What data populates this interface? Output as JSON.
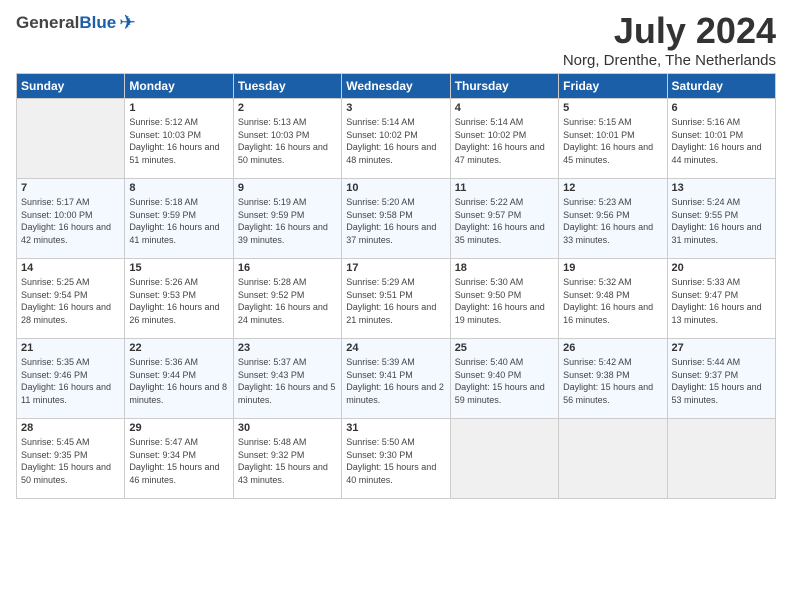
{
  "logo": {
    "general": "General",
    "blue": "Blue"
  },
  "header": {
    "month": "July 2024",
    "location": "Norg, Drenthe, The Netherlands"
  },
  "weekdays": [
    "Sunday",
    "Monday",
    "Tuesday",
    "Wednesday",
    "Thursday",
    "Friday",
    "Saturday"
  ],
  "weeks": [
    [
      {
        "day": "",
        "empty": true
      },
      {
        "day": "1",
        "sunrise": "Sunrise: 5:12 AM",
        "sunset": "Sunset: 10:03 PM",
        "daylight": "Daylight: 16 hours and 51 minutes."
      },
      {
        "day": "2",
        "sunrise": "Sunrise: 5:13 AM",
        "sunset": "Sunset: 10:03 PM",
        "daylight": "Daylight: 16 hours and 50 minutes."
      },
      {
        "day": "3",
        "sunrise": "Sunrise: 5:14 AM",
        "sunset": "Sunset: 10:02 PM",
        "daylight": "Daylight: 16 hours and 48 minutes."
      },
      {
        "day": "4",
        "sunrise": "Sunrise: 5:14 AM",
        "sunset": "Sunset: 10:02 PM",
        "daylight": "Daylight: 16 hours and 47 minutes."
      },
      {
        "day": "5",
        "sunrise": "Sunrise: 5:15 AM",
        "sunset": "Sunset: 10:01 PM",
        "daylight": "Daylight: 16 hours and 45 minutes."
      },
      {
        "day": "6",
        "sunrise": "Sunrise: 5:16 AM",
        "sunset": "Sunset: 10:01 PM",
        "daylight": "Daylight: 16 hours and 44 minutes."
      }
    ],
    [
      {
        "day": "7",
        "sunrise": "Sunrise: 5:17 AM",
        "sunset": "Sunset: 10:00 PM",
        "daylight": "Daylight: 16 hours and 42 minutes."
      },
      {
        "day": "8",
        "sunrise": "Sunrise: 5:18 AM",
        "sunset": "Sunset: 9:59 PM",
        "daylight": "Daylight: 16 hours and 41 minutes."
      },
      {
        "day": "9",
        "sunrise": "Sunrise: 5:19 AM",
        "sunset": "Sunset: 9:59 PM",
        "daylight": "Daylight: 16 hours and 39 minutes."
      },
      {
        "day": "10",
        "sunrise": "Sunrise: 5:20 AM",
        "sunset": "Sunset: 9:58 PM",
        "daylight": "Daylight: 16 hours and 37 minutes."
      },
      {
        "day": "11",
        "sunrise": "Sunrise: 5:22 AM",
        "sunset": "Sunset: 9:57 PM",
        "daylight": "Daylight: 16 hours and 35 minutes."
      },
      {
        "day": "12",
        "sunrise": "Sunrise: 5:23 AM",
        "sunset": "Sunset: 9:56 PM",
        "daylight": "Daylight: 16 hours and 33 minutes."
      },
      {
        "day": "13",
        "sunrise": "Sunrise: 5:24 AM",
        "sunset": "Sunset: 9:55 PM",
        "daylight": "Daylight: 16 hours and 31 minutes."
      }
    ],
    [
      {
        "day": "14",
        "sunrise": "Sunrise: 5:25 AM",
        "sunset": "Sunset: 9:54 PM",
        "daylight": "Daylight: 16 hours and 28 minutes."
      },
      {
        "day": "15",
        "sunrise": "Sunrise: 5:26 AM",
        "sunset": "Sunset: 9:53 PM",
        "daylight": "Daylight: 16 hours and 26 minutes."
      },
      {
        "day": "16",
        "sunrise": "Sunrise: 5:28 AM",
        "sunset": "Sunset: 9:52 PM",
        "daylight": "Daylight: 16 hours and 24 minutes."
      },
      {
        "day": "17",
        "sunrise": "Sunrise: 5:29 AM",
        "sunset": "Sunset: 9:51 PM",
        "daylight": "Daylight: 16 hours and 21 minutes."
      },
      {
        "day": "18",
        "sunrise": "Sunrise: 5:30 AM",
        "sunset": "Sunset: 9:50 PM",
        "daylight": "Daylight: 16 hours and 19 minutes."
      },
      {
        "day": "19",
        "sunrise": "Sunrise: 5:32 AM",
        "sunset": "Sunset: 9:48 PM",
        "daylight": "Daylight: 16 hours and 16 minutes."
      },
      {
        "day": "20",
        "sunrise": "Sunrise: 5:33 AM",
        "sunset": "Sunset: 9:47 PM",
        "daylight": "Daylight: 16 hours and 13 minutes."
      }
    ],
    [
      {
        "day": "21",
        "sunrise": "Sunrise: 5:35 AM",
        "sunset": "Sunset: 9:46 PM",
        "daylight": "Daylight: 16 hours and 11 minutes."
      },
      {
        "day": "22",
        "sunrise": "Sunrise: 5:36 AM",
        "sunset": "Sunset: 9:44 PM",
        "daylight": "Daylight: 16 hours and 8 minutes."
      },
      {
        "day": "23",
        "sunrise": "Sunrise: 5:37 AM",
        "sunset": "Sunset: 9:43 PM",
        "daylight": "Daylight: 16 hours and 5 minutes."
      },
      {
        "day": "24",
        "sunrise": "Sunrise: 5:39 AM",
        "sunset": "Sunset: 9:41 PM",
        "daylight": "Daylight: 16 hours and 2 minutes."
      },
      {
        "day": "25",
        "sunrise": "Sunrise: 5:40 AM",
        "sunset": "Sunset: 9:40 PM",
        "daylight": "Daylight: 15 hours and 59 minutes."
      },
      {
        "day": "26",
        "sunrise": "Sunrise: 5:42 AM",
        "sunset": "Sunset: 9:38 PM",
        "daylight": "Daylight: 15 hours and 56 minutes."
      },
      {
        "day": "27",
        "sunrise": "Sunrise: 5:44 AM",
        "sunset": "Sunset: 9:37 PM",
        "daylight": "Daylight: 15 hours and 53 minutes."
      }
    ],
    [
      {
        "day": "28",
        "sunrise": "Sunrise: 5:45 AM",
        "sunset": "Sunset: 9:35 PM",
        "daylight": "Daylight: 15 hours and 50 minutes."
      },
      {
        "day": "29",
        "sunrise": "Sunrise: 5:47 AM",
        "sunset": "Sunset: 9:34 PM",
        "daylight": "Daylight: 15 hours and 46 minutes."
      },
      {
        "day": "30",
        "sunrise": "Sunrise: 5:48 AM",
        "sunset": "Sunset: 9:32 PM",
        "daylight": "Daylight: 15 hours and 43 minutes."
      },
      {
        "day": "31",
        "sunrise": "Sunrise: 5:50 AM",
        "sunset": "Sunset: 9:30 PM",
        "daylight": "Daylight: 15 hours and 40 minutes."
      },
      {
        "day": "",
        "empty": true
      },
      {
        "day": "",
        "empty": true
      },
      {
        "day": "",
        "empty": true
      }
    ]
  ]
}
